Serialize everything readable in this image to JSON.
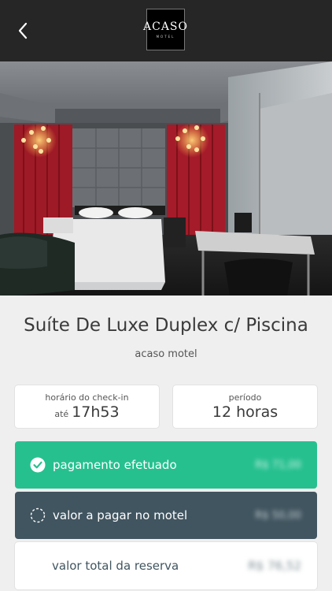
{
  "header": {
    "logo_text": "ACASO",
    "logo_subtext": "MOTEL"
  },
  "suite": {
    "name": "Suíte De Luxe Duplex c/ Piscina",
    "venue": "acaso motel"
  },
  "checkin": {
    "label": "horário do check-in",
    "prefix": "até",
    "time": "17h53"
  },
  "period": {
    "label": "período",
    "value": "12 horas"
  },
  "payments": {
    "paid_label": "pagamento efetuado",
    "paid_amount": "R$ 71,00",
    "due_label": "valor a pagar no motel",
    "due_amount": "R$ 50,00",
    "total_label": "valor total da reserva",
    "total_amount": "R$ 76,52"
  },
  "colors": {
    "topbar": "#262626",
    "paid": "#26c08f",
    "due": "#415560",
    "background": "#efefef"
  }
}
